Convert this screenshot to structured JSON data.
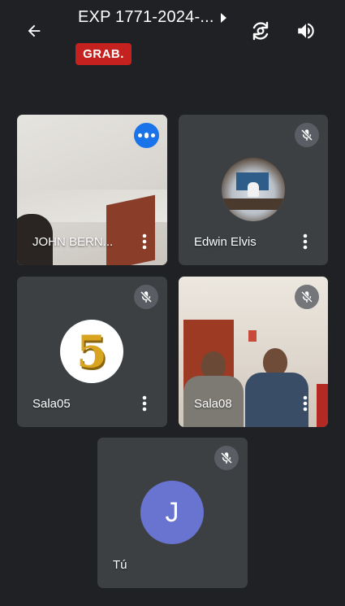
{
  "header": {
    "title": "EXP 1771-2024-...",
    "recording_badge": "GRAB."
  },
  "participants": [
    {
      "name": "JOHN BERN...",
      "state": "speaking",
      "media": "video"
    },
    {
      "name": "Edwin Elvis",
      "state": "muted",
      "media": "avatar-photo"
    },
    {
      "name": "Sala05",
      "state": "muted",
      "media": "avatar-image",
      "avatar_text": "5"
    },
    {
      "name": "Sala08",
      "state": "muted",
      "media": "video"
    },
    {
      "name": "Tú",
      "state": "muted",
      "media": "avatar-initial",
      "avatar_initial": "J",
      "avatar_color": "#6874d0"
    }
  ],
  "colors": {
    "background": "#202124",
    "tile": "#3c4043",
    "recording": "#c5221f",
    "speaking": "#1a73e8"
  }
}
